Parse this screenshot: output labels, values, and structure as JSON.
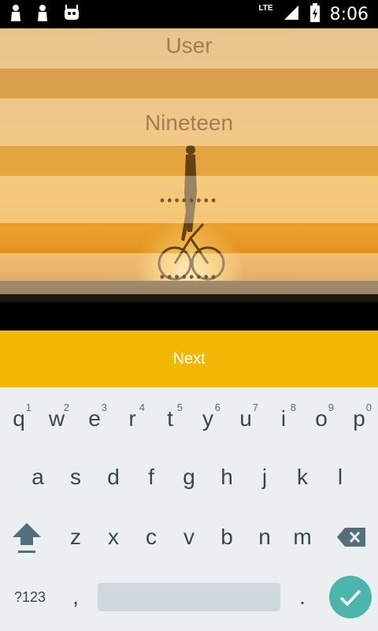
{
  "status_bar": {
    "time": "8:06",
    "network": "LTE",
    "icons": [
      "person-icon",
      "person-icon",
      "android-icon",
      "signal-icon",
      "battery-icon"
    ]
  },
  "form": {
    "username_value": "User",
    "name_value": "Nineteen",
    "password_mask": "••••••••",
    "confirm_password_mask": "••••••••"
  },
  "next_button": {
    "label": "Next",
    "color": "#f2b705"
  },
  "keyboard": {
    "row1": [
      {
        "key": "q",
        "hint": "1"
      },
      {
        "key": "w",
        "hint": "2"
      },
      {
        "key": "e",
        "hint": "3"
      },
      {
        "key": "r",
        "hint": "4"
      },
      {
        "key": "t",
        "hint": "5"
      },
      {
        "key": "y",
        "hint": "6"
      },
      {
        "key": "u",
        "hint": "7"
      },
      {
        "key": "i",
        "hint": "8"
      },
      {
        "key": "o",
        "hint": "9"
      },
      {
        "key": "p",
        "hint": "0"
      }
    ],
    "row2": [
      "a",
      "s",
      "d",
      "f",
      "g",
      "h",
      "j",
      "k",
      "l"
    ],
    "row3": [
      "z",
      "x",
      "c",
      "v",
      "b",
      "n",
      "m"
    ],
    "symbols_label": "?123",
    "comma": ",",
    "period": ".",
    "accent_color": "#4db6ac"
  }
}
